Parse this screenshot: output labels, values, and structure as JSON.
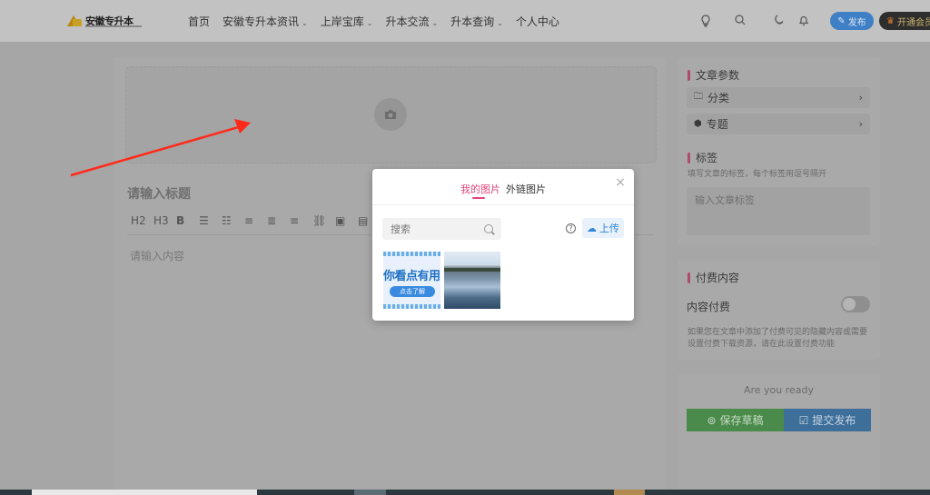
{
  "header": {
    "logo_text": "安徽专升本",
    "nav": [
      {
        "label": "首页",
        "dropdown": false
      },
      {
        "label": "安徽专升本资讯",
        "dropdown": true
      },
      {
        "label": "上岸宝库",
        "dropdown": true
      },
      {
        "label": "升本交流",
        "dropdown": true
      },
      {
        "label": "升本查询",
        "dropdown": true
      },
      {
        "label": "个人中心",
        "dropdown": false
      }
    ],
    "icons": [
      "lightbulb-icon",
      "search-icon",
      "moon-icon",
      "bell-icon"
    ],
    "publish_label": "发布",
    "vip_label": "开通会员"
  },
  "editor": {
    "title_placeholder": "请输入标题",
    "toolbar": [
      "H2",
      "H3",
      "B",
      "☰",
      "☷",
      "≡",
      "≣",
      "≡",
      "⛓",
      "▣",
      "▤"
    ],
    "content_placeholder": "请输入内容"
  },
  "sidebar": {
    "article_params_title": "文章参数",
    "category_label": "分类",
    "topic_label": "专题",
    "tags_title": "标签",
    "tags_hint": "填写文章的标签，每个标签用逗号隔开",
    "tags_placeholder": "输入文章标签",
    "paid_title": "付费内容",
    "paid_toggle_label": "内容付费",
    "paid_hint": "如果您在文章中添加了付费可见的隐藏内容或需要设置付费下载资源，请在此设置付费功能",
    "ready_text": "Are you ready",
    "save_label": "保存草稿",
    "submit_label": "提交发布"
  },
  "modal": {
    "tab_mine": "我的图片",
    "tab_external": "外链图片",
    "search_placeholder": "搜索",
    "help_glyph": "?",
    "upload_label": "上传",
    "thumb1_text": "你看点有用",
    "thumb1_button": "点击了解"
  },
  "colors": {
    "accent_pink": "#e0457b",
    "upload_blue": "#2f86d6",
    "save_green": "#4a8a4a",
    "submit_blue": "#3e6f9a",
    "arrow_red": "#ff2a1a"
  }
}
